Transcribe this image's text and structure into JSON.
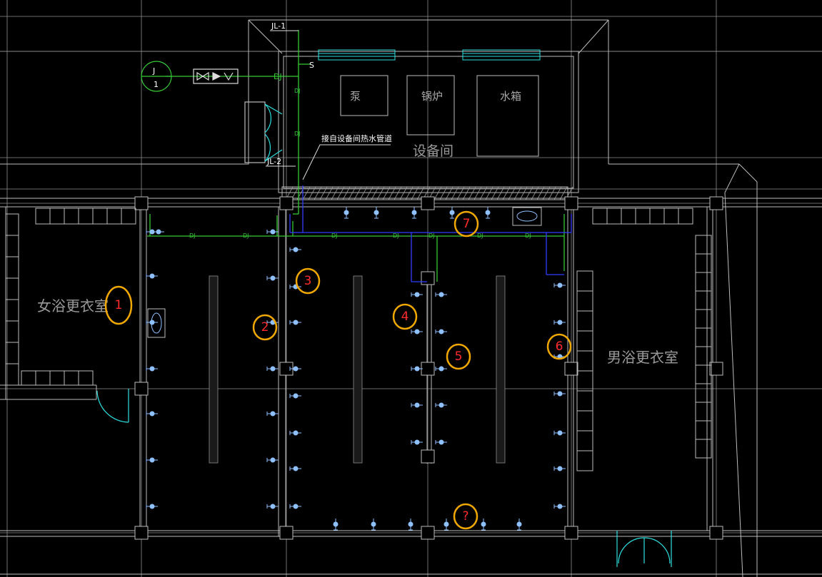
{
  "drawing": {
    "rooms": {
      "women_changing": "女浴更衣室",
      "men_changing": "男浴更衣室",
      "equipment_room": "设备间"
    },
    "equipment": {
      "pump": "泵",
      "boiler": "锅炉",
      "water_tank": "水箱"
    },
    "pipe_labels": {
      "riser_1": "JL-1",
      "riser_2": "JL-2",
      "note": "接自设备间热水管道",
      "meter_symbol": "J",
      "meter_number": "1",
      "pipe_code": "DJ",
      "riser_letter": "S"
    },
    "markers": [
      "1",
      "2",
      "3",
      "4",
      "5",
      "6",
      "7",
      "?"
    ],
    "colors": {
      "background": "#000000",
      "grid": "#8f8f8f",
      "wall": "#bcbcbc",
      "supply_pipe": "#35c935",
      "hot_pipe": "#2f3dff",
      "fixture": "#8fc0ff",
      "marker_ring": "#f0a800",
      "marker_text": "#ff2b2b",
      "vent": "#2ee0e0"
    }
  }
}
